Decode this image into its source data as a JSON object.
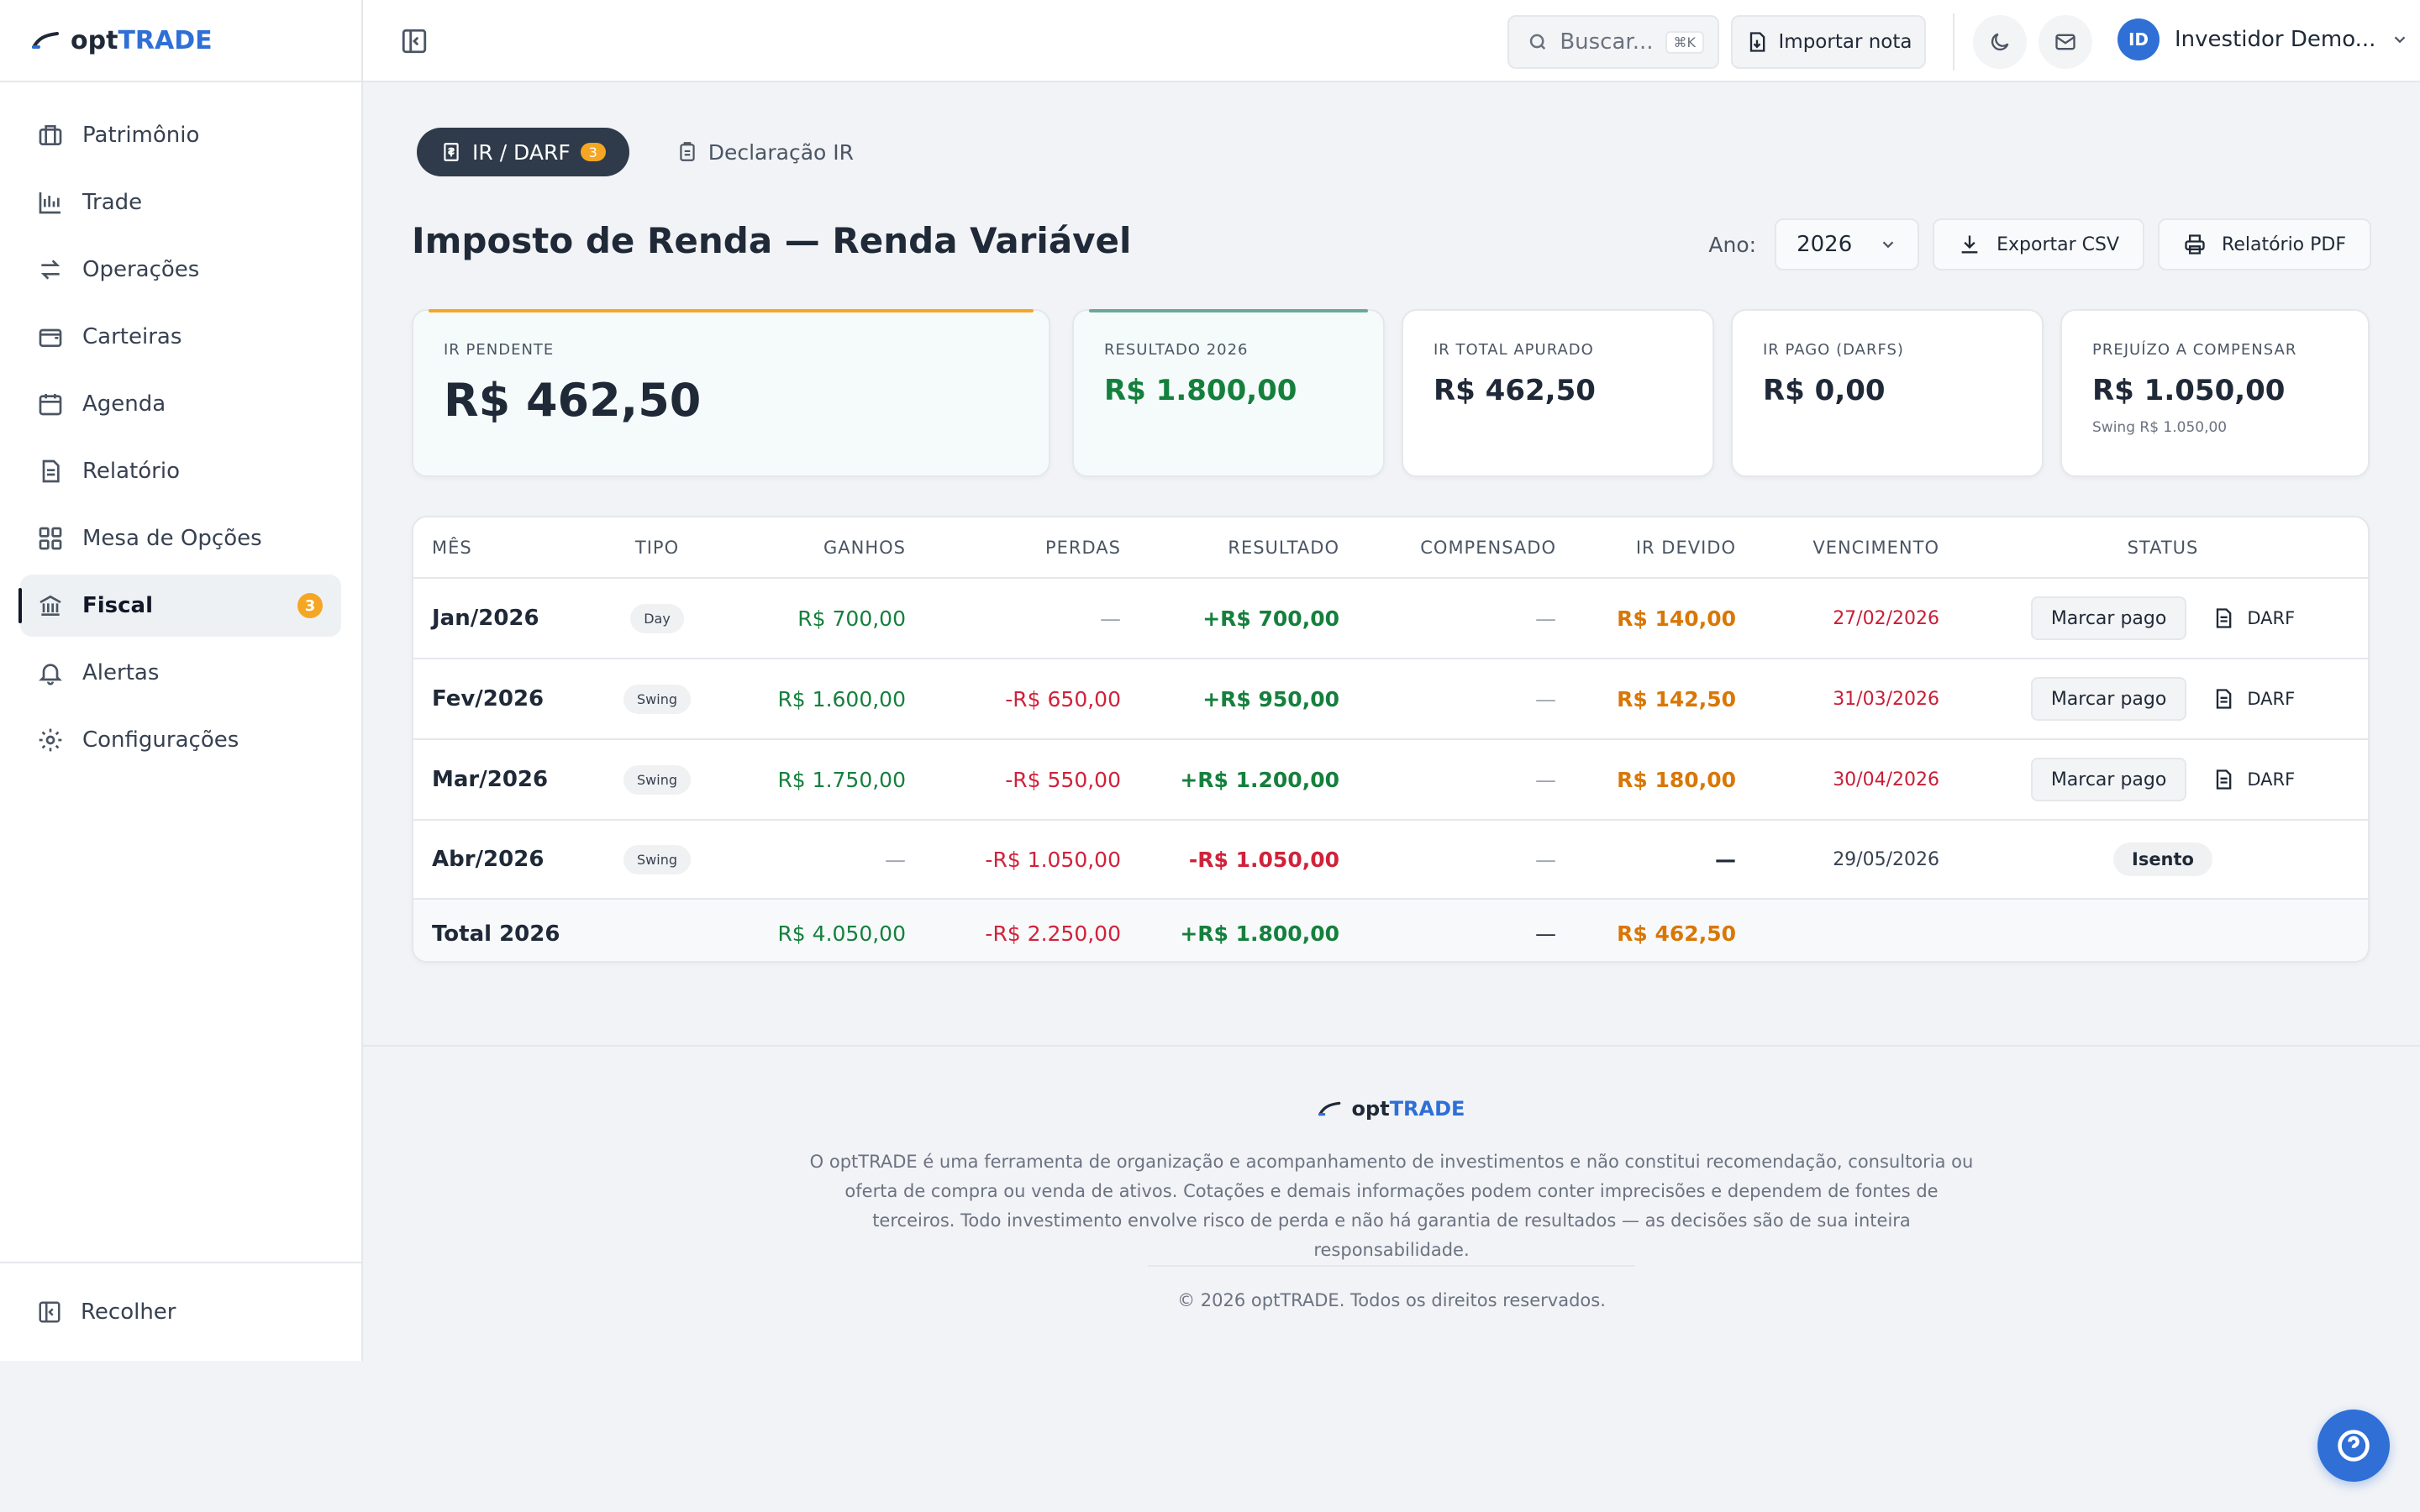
{
  "brand": {
    "name_prefix": "opt",
    "name_accent": "TRADE"
  },
  "sidebar": {
    "items": [
      {
        "label": "Patrimônio",
        "icon": "briefcase-icon"
      },
      {
        "label": "Trade",
        "icon": "chart-icon"
      },
      {
        "label": "Operações",
        "icon": "arrows-icon"
      },
      {
        "label": "Carteiras",
        "icon": "wallet-icon"
      },
      {
        "label": "Agenda",
        "icon": "calendar-icon"
      },
      {
        "label": "Relatório",
        "icon": "document-icon"
      },
      {
        "label": "Mesa de Opções",
        "icon": "grid-icon"
      },
      {
        "label": "Fiscal",
        "icon": "bank-icon",
        "badge": "3",
        "active": true
      },
      {
        "label": "Alertas",
        "icon": "bell-icon"
      },
      {
        "label": "Configurações",
        "icon": "gear-icon"
      }
    ],
    "collapse_label": "Recolher"
  },
  "topbar": {
    "search_placeholder": "Buscar...",
    "search_shortcut": "⌘K",
    "import_label": "Importar nota",
    "user_initials": "ID",
    "user_name": "Investidor Demo..."
  },
  "tabs": [
    {
      "label": "IR / DARF",
      "badge": "3",
      "active": true
    },
    {
      "label": "Declaração IR",
      "active": false
    }
  ],
  "page": {
    "title": "Imposto de Renda — Renda Variável",
    "year_label": "Ano:",
    "year_value": "2026",
    "export_csv": "Exportar CSV",
    "report_pdf": "Relatório PDF"
  },
  "cards": {
    "ir_pendente": {
      "label": "IR PENDENTE",
      "value": "R$ 462,50"
    },
    "resultado": {
      "label": "RESULTADO 2026",
      "value": "R$ 1.800,00"
    },
    "ir_total": {
      "label": "IR TOTAL APURADO",
      "value": "R$ 462,50"
    },
    "ir_pago": {
      "label": "IR PAGO (DARFS)",
      "value": "R$ 0,00"
    },
    "prejuizo": {
      "label": "PREJUÍZO A COMPENSAR",
      "value": "R$ 1.050,00",
      "sub": "Swing R$ 1.050,00"
    }
  },
  "table": {
    "headers": {
      "mes": "MÊS",
      "tipo": "TIPO",
      "ganhos": "GANHOS",
      "perdas": "PERDAS",
      "resultado": "RESULTADO",
      "compensado": "COMPENSADO",
      "ir_devido": "IR DEVIDO",
      "vencimento": "VENCIMENTO",
      "status": "STATUS"
    },
    "rows": [
      {
        "mes": "Jan/2026",
        "tipo": "Day",
        "ganhos": "R$ 700,00",
        "perdas": "—",
        "resultado": "+R$ 700,00",
        "compensado": "—",
        "ir_devido": "R$ 140,00",
        "vencimento": "27/02/2026",
        "action": "Marcar pago",
        "darf": "DARF"
      },
      {
        "mes": "Fev/2026",
        "tipo": "Swing",
        "ganhos": "R$ 1.600,00",
        "perdas": "-R$ 650,00",
        "resultado": "+R$ 950,00",
        "compensado": "—",
        "ir_devido": "R$ 142,50",
        "vencimento": "31/03/2026",
        "action": "Marcar pago",
        "darf": "DARF"
      },
      {
        "mes": "Mar/2026",
        "tipo": "Swing",
        "ganhos": "R$ 1.750,00",
        "perdas": "-R$ 550,00",
        "resultado": "+R$ 1.200,00",
        "compensado": "—",
        "ir_devido": "R$ 180,00",
        "vencimento": "30/04/2026",
        "action": "Marcar pago",
        "darf": "DARF"
      },
      {
        "mes": "Abr/2026",
        "tipo": "Swing",
        "ganhos": "—",
        "perdas": "-R$ 1.050,00",
        "resultado": "-R$ 1.050,00",
        "compensado": "—",
        "ir_devido": "—",
        "vencimento": "29/05/2026",
        "status": "Isento"
      }
    ],
    "total": {
      "label": "Total 2026",
      "ganhos": "R$ 4.050,00",
      "perdas": "-R$ 2.250,00",
      "resultado": "+R$ 1.800,00",
      "compensado": "—",
      "ir_devido": "R$ 462,50"
    }
  },
  "footer": {
    "disclaimer": "O optTRADE é uma ferramenta de organização e acompanhamento de investimentos e não constitui recomendação, consultoria ou oferta de compra ou venda de ativos. Cotações e demais informações podem conter imprecisões e dependem de fontes de terceiros. Todo investimento envolve risco de perda e não há garantia de resultados — as decisões são de sua inteira responsabilidade.",
    "copyright": "© 2026 optTRADE. Todos os direitos reservados."
  },
  "colors": {
    "accent": "#2f6fd6",
    "positive": "#15803d",
    "negative": "#d0223a",
    "warning": "#d97706",
    "badge": "#f5a623"
  }
}
